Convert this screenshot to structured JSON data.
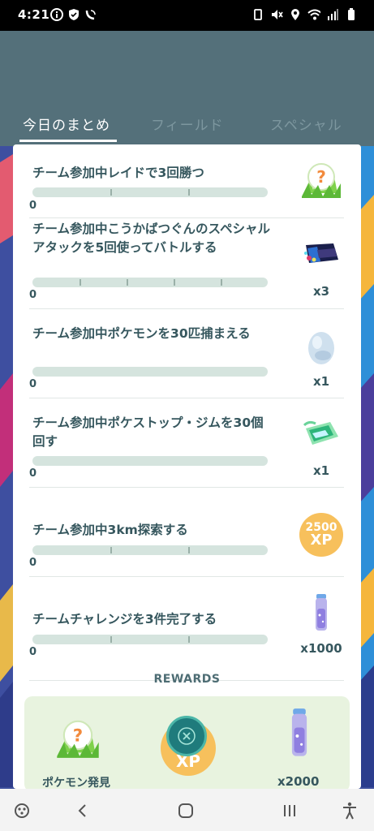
{
  "status_bar": {
    "time": "4:21",
    "icons": [
      "info-icon",
      "shield-icon",
      "wifi-calling-icon",
      "vibrate-icon",
      "mute-icon",
      "location-icon",
      "wifi-icon",
      "signal-icon",
      "battery-icon"
    ]
  },
  "tabs": [
    {
      "label": "今日のまとめ",
      "active": true
    },
    {
      "label": "フィールド",
      "active": false
    },
    {
      "label": "スペシャル",
      "active": false
    }
  ],
  "tasks": [
    {
      "title": "チーム参加中レイドで3回勝つ",
      "count": "0",
      "reward_icon": "mystery-pokemon-icon",
      "qty": ""
    },
    {
      "title": "チーム参加中こうかばつぐんのスペシャルアタックを5回使ってバトルする",
      "count": "0",
      "reward_icon": "tm-disc-icon",
      "qty": "x3"
    },
    {
      "title": "チーム参加中ポケモンを30匹捕まえる",
      "count": "0",
      "reward_icon": "egg-icon",
      "qty": "x1"
    },
    {
      "title": "チーム参加中ポケストップ・ジムを30個回す",
      "count": "0",
      "reward_icon": "incense-icon",
      "qty": "x1"
    },
    {
      "title": "チーム参加中3km探索する",
      "count": "0",
      "reward_icon": "xp-badge-icon",
      "qty": ""
    },
    {
      "title": "チームチャレンジを3件完了する",
      "count": "0",
      "reward_icon": "stardust-tube-icon",
      "qty": "x1000"
    }
  ],
  "xp_badge": {
    "amount": "2500",
    "unit": "XP"
  },
  "rewards": {
    "heading": "REWARDS",
    "items": [
      {
        "label": "ポケモン発見",
        "icon": "mystery-pokemon-icon"
      },
      {
        "label": "",
        "icon": "xp-badge-icon",
        "text": "XP"
      },
      {
        "label": "x2000",
        "icon": "stardust-tube-icon"
      }
    ]
  },
  "colors": {
    "header": "#54707a",
    "accent": "#f7c05c",
    "bar": "#d5e4de"
  }
}
